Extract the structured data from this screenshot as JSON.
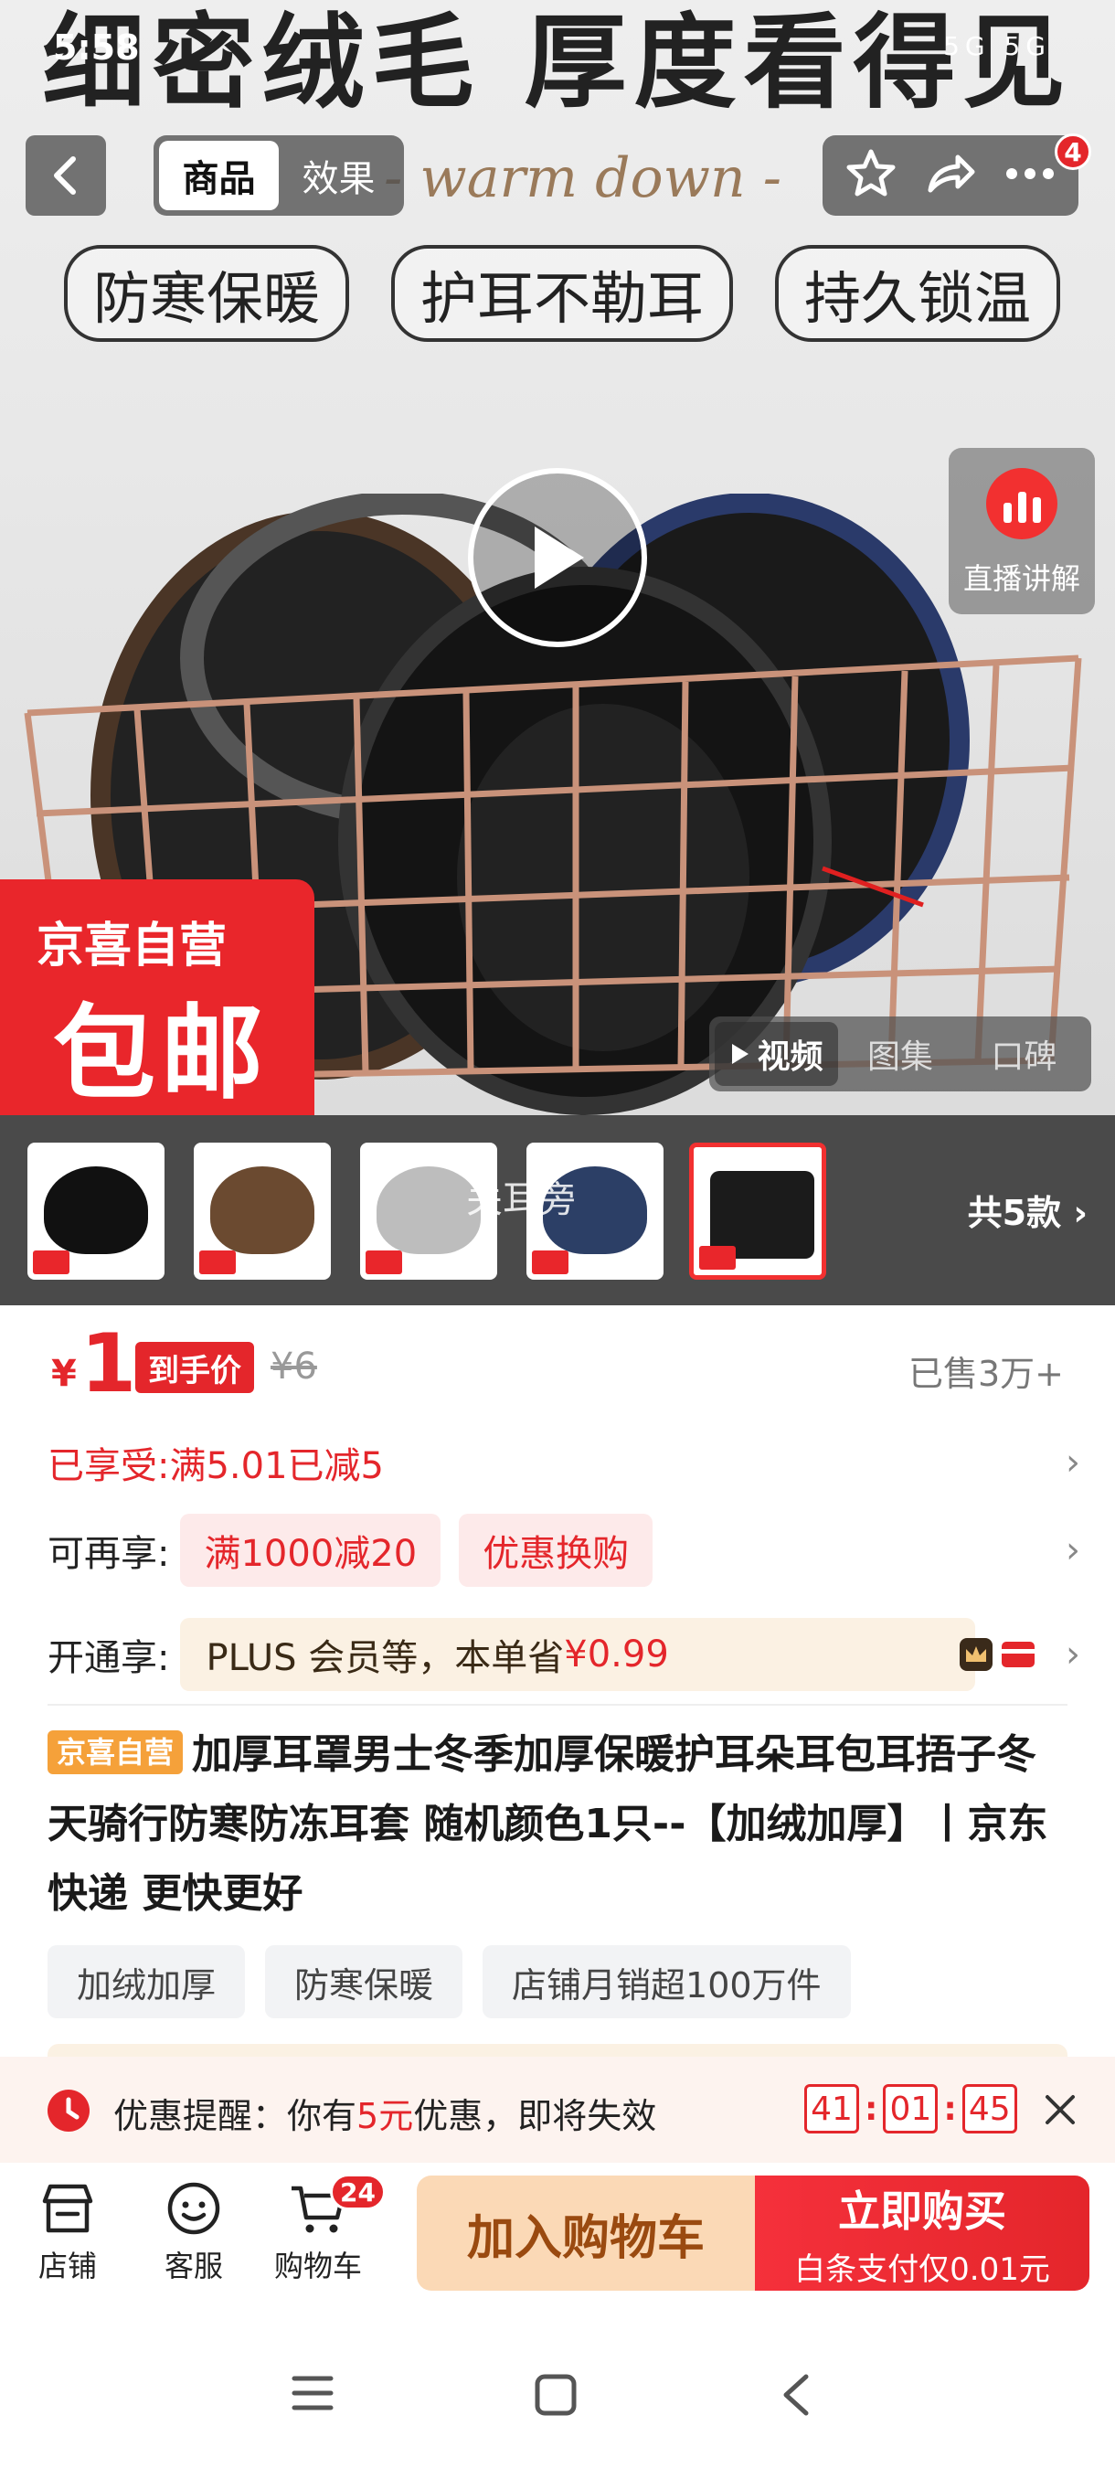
{
  "status_bar": {
    "time": "5:58",
    "right_text": "5G 5G"
  },
  "hero": {
    "headline": "细密绒毛 厚度看得见",
    "subline": "- warm down -",
    "tags": [
      "防寒保暖",
      "护耳不勒耳",
      "持久锁温"
    ],
    "live_label": "直播讲解",
    "badge_top": "京喜自营",
    "badge_big": "包邮",
    "media_tabs": [
      "视频",
      "图集",
      "口碑"
    ],
    "media_tab_active": "视频"
  },
  "nav": {
    "segments": [
      "商品",
      "效果"
    ],
    "active_segment": "商品",
    "more_badge": "4"
  },
  "thumbnails": {
    "overlay_text": "关耳旁",
    "count_label": "共5款",
    "items": [
      {
        "color": "#111111"
      },
      {
        "color": "#6b4a30"
      },
      {
        "color": "#bdbdbd"
      },
      {
        "color": "#2c3f66"
      },
      {
        "color": "#1b1b1b"
      }
    ]
  },
  "price": {
    "currency": "¥",
    "value": "1",
    "tag": "到手价",
    "original": "¥6",
    "sold": "已售3万+"
  },
  "promos": {
    "enjoyed_label": "已享受:",
    "enjoyed_value": "满5.01已减5",
    "more_label": "可再享:",
    "more_chips": [
      "满1000减20",
      "优惠换购"
    ],
    "plus_label": "开通享:",
    "plus_text": "PLUS 会员等，本单省",
    "plus_amount": "¥0.99"
  },
  "product": {
    "self_tag": "京喜自营",
    "title": "加厚耳罩男士冬季加厚保暖护耳朵耳包耳捂子冬天骑行防寒防冻耳套 随机颜色1只--【加绒加厚】丨京东快递 更快更好",
    "feature_tags": [
      "加绒加厚",
      "防寒保暖",
      "店铺月销超100万件"
    ]
  },
  "reminder": {
    "prefix": "优惠提醒：你有",
    "amount": "5元",
    "suffix": "优惠，即将失效",
    "timer": [
      "41",
      "01",
      "45"
    ]
  },
  "bottom_bar": {
    "store_label": "店铺",
    "service_label": "客服",
    "cart_label": "购物车",
    "cart_badge": "24",
    "add_cart": "加入购物车",
    "buy_now": "立即购买",
    "buy_sub": "白条支付仅0.01元"
  },
  "colors": {
    "accent_red": "#e4262b",
    "cart_button": "#fbd9b6",
    "self_tag": "#f5a13a"
  }
}
